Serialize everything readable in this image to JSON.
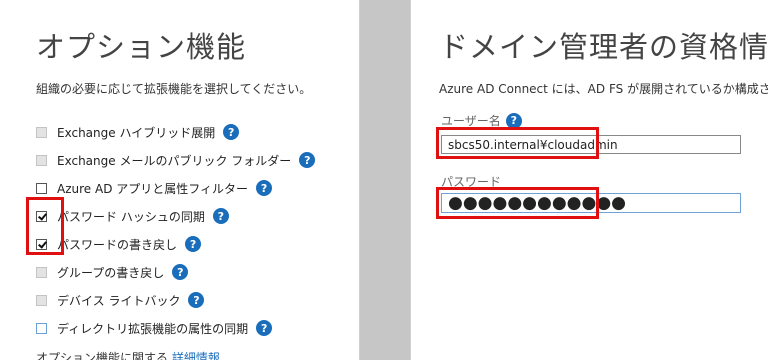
{
  "left": {
    "title": "オプション機能",
    "description": "組織の必要に応じて拡張機能を選択してください。",
    "options": [
      {
        "label": "Exchange ハイブリッド展開",
        "state": "disabled"
      },
      {
        "label": "Exchange メールのパブリック フォルダー",
        "state": "disabled"
      },
      {
        "label": "Azure AD アプリと属性フィルター",
        "state": "unchecked"
      },
      {
        "label": "パスワード ハッシュの同期",
        "state": "checked"
      },
      {
        "label": "パスワードの書き戻し",
        "state": "checked"
      },
      {
        "label": "グループの書き戻し",
        "state": "disabled"
      },
      {
        "label": "デバイス ライトバック",
        "state": "disabled"
      },
      {
        "label": "ディレクトリ拡張機能の属性の同期",
        "state": "unchecked-blue"
      }
    ],
    "help_glyph": "?",
    "footer_text": "オプション機能に関する",
    "footer_link": "詳細情報"
  },
  "right": {
    "title": "ドメイン管理者の資格情報",
    "description": "Azure AD Connect には、AD FS が展開されているか構成されて",
    "username_label": "ユーザー名",
    "username_value": "sbcs50.internal¥cloudadmin",
    "password_label": "パスワード",
    "password_value": "●●●●●●●●●●●●"
  },
  "colors": {
    "highlight": "#e01010",
    "help_icon": "#1a6dbb",
    "gap": "#c6c6c6"
  }
}
